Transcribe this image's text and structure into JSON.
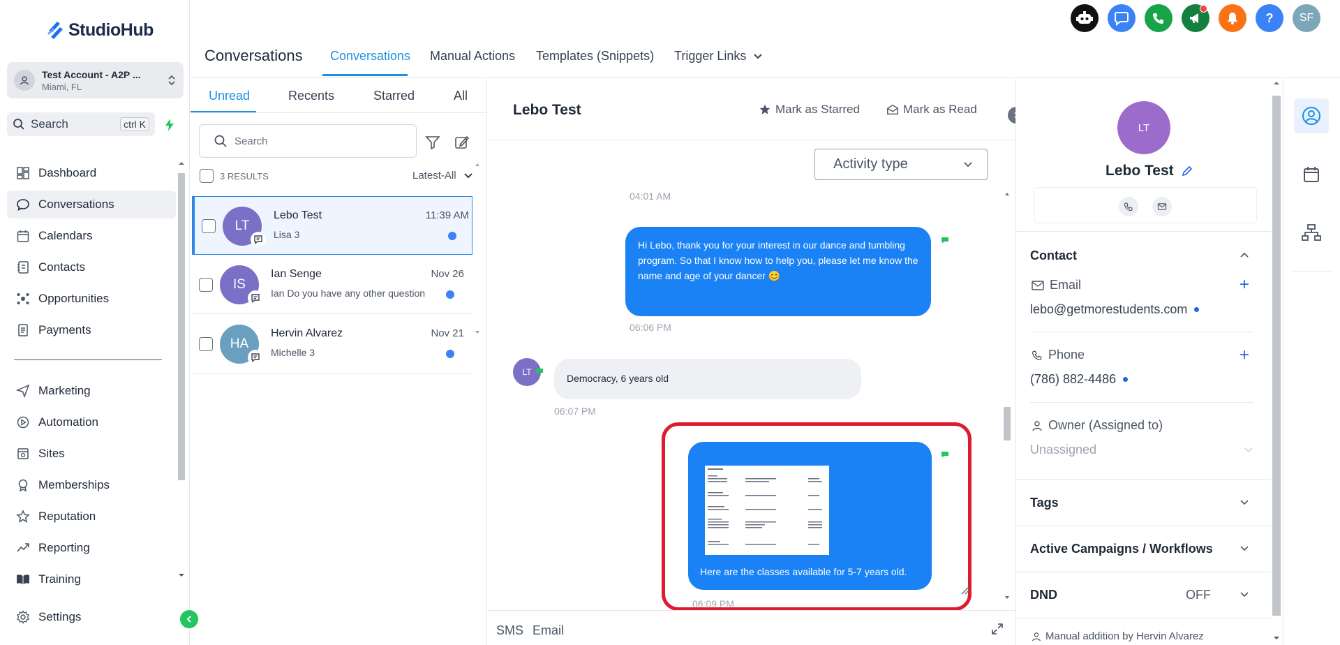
{
  "app": {
    "logo_text": "StudioHub",
    "account": {
      "name": "Test Account - A2P ...",
      "location": "Miami, FL"
    },
    "search": {
      "label": "Search",
      "shortcut": "ctrl K"
    }
  },
  "sidebar": {
    "items": [
      {
        "label": "Dashboard",
        "icon": "dashboard-icon"
      },
      {
        "label": "Conversations",
        "icon": "chat-icon",
        "active": true
      },
      {
        "label": "Calendars",
        "icon": "calendar-icon"
      },
      {
        "label": "Contacts",
        "icon": "contacts-icon"
      },
      {
        "label": "Opportunities",
        "icon": "opportunities-icon"
      },
      {
        "label": "Payments",
        "icon": "payments-icon"
      },
      {
        "label": "Marketing",
        "icon": "send-icon"
      },
      {
        "label": "Automation",
        "icon": "automation-icon"
      },
      {
        "label": "Sites",
        "icon": "sites-icon"
      },
      {
        "label": "Memberships",
        "icon": "memberships-icon"
      },
      {
        "label": "Reputation",
        "icon": "star-icon"
      },
      {
        "label": "Reporting",
        "icon": "chart-icon"
      },
      {
        "label": "Training",
        "icon": "book-icon"
      }
    ],
    "settings_label": "Settings"
  },
  "header": {
    "title": "Conversations",
    "tabs": [
      "Conversations",
      "Manual Actions",
      "Templates (Snippets)",
      "Trigger Links"
    ],
    "active_tab": "Conversations",
    "user_initials": "SF",
    "help_label": "?"
  },
  "list": {
    "tabs": [
      "Unread",
      "Recents",
      "Starred",
      "All"
    ],
    "active_tab": "Unread",
    "search_placeholder": "Search",
    "results_count": "3 RESULTS",
    "sort": "Latest-All",
    "conversations": [
      {
        "initials": "LT",
        "name": "Lebo Test",
        "preview": "Lisa 3",
        "time": "11:39 AM",
        "unread": true,
        "avatar_color": "#7b6fc6"
      },
      {
        "initials": "IS",
        "name": "Ian Senge",
        "preview": "Ian Do you have any other question",
        "time": "Nov 26",
        "unread": true,
        "avatar_color": "#7b6fc6"
      },
      {
        "initials": "HA",
        "name": "Hervin Alvarez",
        "preview": "Michelle 3",
        "time": "Nov 21",
        "unread": true,
        "avatar_color": "#6a9fbf"
      }
    ]
  },
  "chat": {
    "contact_name": "Lebo Test",
    "mark_starred": "Mark as Starred",
    "mark_read": "Mark as Read",
    "activity_type": "Activity type",
    "messages": [
      {
        "time": "04:01 AM"
      },
      {
        "direction": "outbound",
        "text": "Hi Lebo, thank you for your interest in our dance and tumbling program. So that I know how to help you, please let me know the name and age of your dancer 😊",
        "time": "06:06 PM"
      },
      {
        "direction": "inbound",
        "sender_initials": "LT",
        "text": "Democracy, 6 years old",
        "time": "06:07 PM"
      },
      {
        "direction": "outbound",
        "attachment": "schedule-image",
        "text": "Here are the classes available for 5-7 years old.",
        "time": "06:09 PM"
      }
    ],
    "composer_tabs": [
      "SMS",
      "Email"
    ]
  },
  "contact": {
    "initials": "LT",
    "name": "Lebo Test",
    "section_contact": "Contact",
    "email_label": "Email",
    "email": "lebo@getmorestudents.com",
    "phone_label": "Phone",
    "phone": "(786) 882-4486",
    "owner_label": "Owner (Assigned to)",
    "owner_value": "Unassigned",
    "tags_label": "Tags",
    "campaigns_label": "Active Campaigns / Workflows",
    "dnd_label": "DND",
    "dnd_value": "OFF",
    "footer_note": "Manual addition by Hervin Alvarez"
  },
  "colors": {
    "accent": "#1d8fe1",
    "bubble_outbound": "#1a82f5",
    "highlight": "#dc1c2e"
  }
}
